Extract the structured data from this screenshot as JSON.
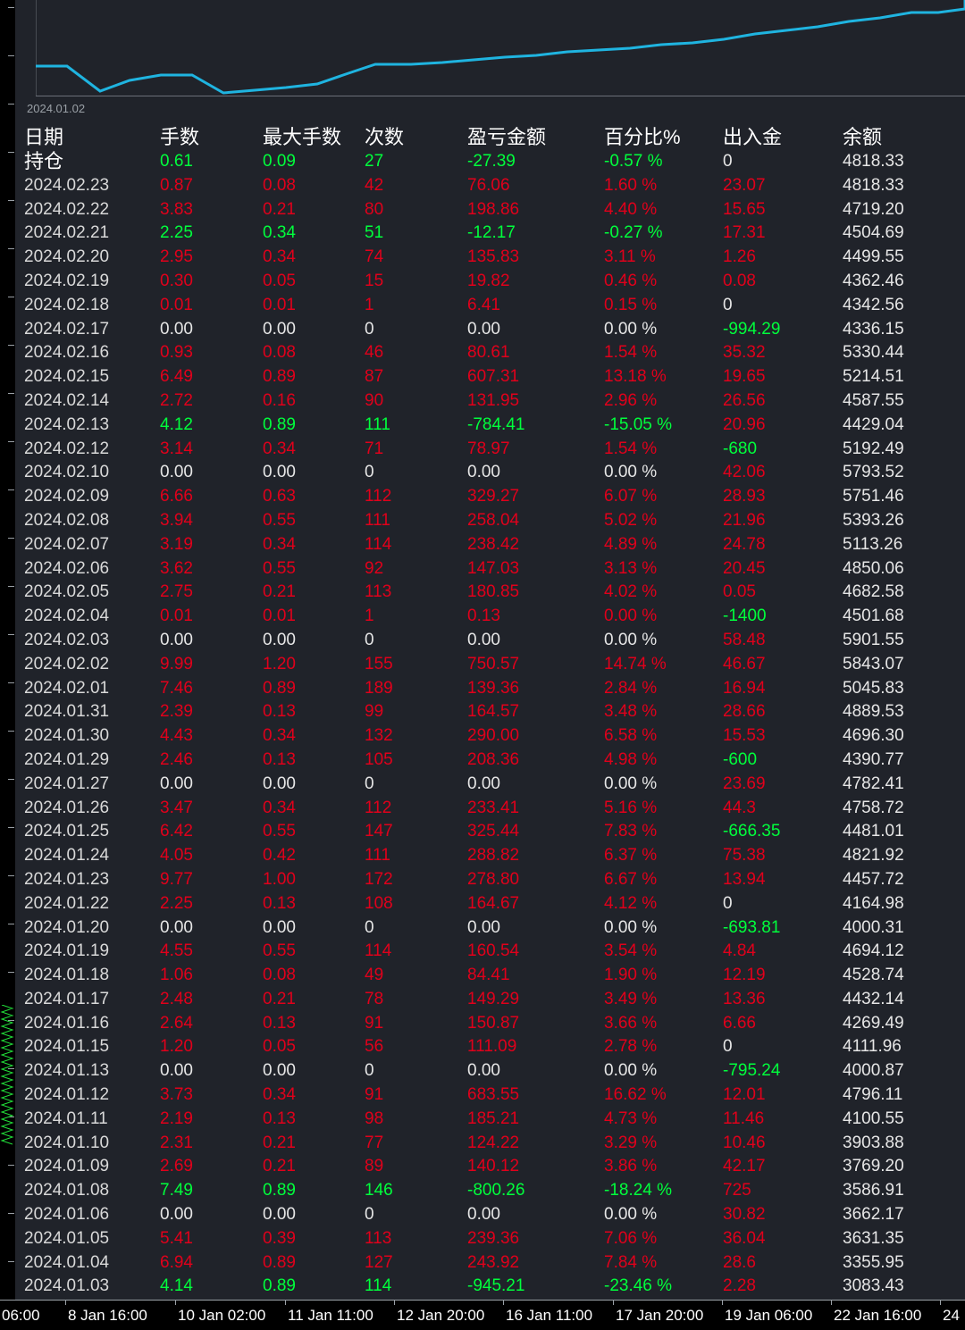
{
  "window": {
    "title": ""
  },
  "equity_curve": {
    "start_label": "2024.01.02",
    "line_color": "#1fb4e0",
    "values": [
      74,
      74,
      102,
      90,
      84,
      84,
      104,
      101,
      98,
      94,
      82,
      72,
      72,
      70,
      67,
      64,
      62,
      58,
      56,
      54,
      50,
      48,
      44,
      38,
      34,
      30,
      24,
      20,
      14,
      14,
      10,
      5,
      2,
      0
    ]
  },
  "stats_table": {
    "headers": [
      "日期",
      "手数",
      "最大手数",
      "次数",
      "盈亏金额",
      "百分比%",
      "出入金",
      "余额"
    ],
    "rows": [
      {
        "date": "持仓",
        "lots": "0.61",
        "max_lots": "0.09",
        "count": "27",
        "pnl": "-27.39",
        "pct": "-0.57 %",
        "cash": "0",
        "balance": "4818.33",
        "color": "g",
        "cash_color": "w"
      },
      {
        "date": "2024.02.23",
        "lots": "0.87",
        "max_lots": "0.08",
        "count": "42",
        "pnl": "76.06",
        "pct": "1.60 %",
        "cash": "23.07",
        "balance": "4818.33",
        "color": "r",
        "cash_color": "r"
      },
      {
        "date": "2024.02.22",
        "lots": "3.83",
        "max_lots": "0.21",
        "count": "80",
        "pnl": "198.86",
        "pct": "4.40 %",
        "cash": "15.65",
        "balance": "4719.20",
        "color": "r",
        "cash_color": "r"
      },
      {
        "date": "2024.02.21",
        "lots": "2.25",
        "max_lots": "0.34",
        "count": "51",
        "pnl": "-12.17",
        "pct": "-0.27 %",
        "cash": "17.31",
        "balance": "4504.69",
        "color": "g",
        "cash_color": "r"
      },
      {
        "date": "2024.02.20",
        "lots": "2.95",
        "max_lots": "0.34",
        "count": "74",
        "pnl": "135.83",
        "pct": "3.11 %",
        "cash": "1.26",
        "balance": "4499.55",
        "color": "r",
        "cash_color": "r"
      },
      {
        "date": "2024.02.19",
        "lots": "0.30",
        "max_lots": "0.05",
        "count": "15",
        "pnl": "19.82",
        "pct": "0.46 %",
        "cash": "0.08",
        "balance": "4362.46",
        "color": "r",
        "cash_color": "r"
      },
      {
        "date": "2024.02.18",
        "lots": "0.01",
        "max_lots": "0.01",
        "count": "1",
        "pnl": "6.41",
        "pct": "0.15 %",
        "cash": "0",
        "balance": "4342.56",
        "color": "r",
        "cash_color": "w"
      },
      {
        "date": "2024.02.17",
        "lots": "0.00",
        "max_lots": "0.00",
        "count": "0",
        "pnl": "0.00",
        "pct": "0.00 %",
        "cash": "-994.29",
        "balance": "4336.15",
        "color": "w",
        "cash_color": "g"
      },
      {
        "date": "2024.02.16",
        "lots": "0.93",
        "max_lots": "0.08",
        "count": "46",
        "pnl": "80.61",
        "pct": "1.54 %",
        "cash": "35.32",
        "balance": "5330.44",
        "color": "r",
        "cash_color": "r"
      },
      {
        "date": "2024.02.15",
        "lots": "6.49",
        "max_lots": "0.89",
        "count": "87",
        "pnl": "607.31",
        "pct": "13.18 %",
        "cash": "19.65",
        "balance": "5214.51",
        "color": "r",
        "cash_color": "r"
      },
      {
        "date": "2024.02.14",
        "lots": "2.72",
        "max_lots": "0.16",
        "count": "90",
        "pnl": "131.95",
        "pct": "2.96 %",
        "cash": "26.56",
        "balance": "4587.55",
        "color": "r",
        "cash_color": "r"
      },
      {
        "date": "2024.02.13",
        "lots": "4.12",
        "max_lots": "0.89",
        "count": "111",
        "pnl": "-784.41",
        "pct": "-15.05 %",
        "cash": "20.96",
        "balance": "4429.04",
        "color": "g",
        "cash_color": "r"
      },
      {
        "date": "2024.02.12",
        "lots": "3.14",
        "max_lots": "0.34",
        "count": "71",
        "pnl": "78.97",
        "pct": "1.54 %",
        "cash": "-680",
        "balance": "5192.49",
        "color": "r",
        "cash_color": "g"
      },
      {
        "date": "2024.02.10",
        "lots": "0.00",
        "max_lots": "0.00",
        "count": "0",
        "pnl": "0.00",
        "pct": "0.00 %",
        "cash": "42.06",
        "balance": "5793.52",
        "color": "w",
        "cash_color": "r"
      },
      {
        "date": "2024.02.09",
        "lots": "6.66",
        "max_lots": "0.63",
        "count": "112",
        "pnl": "329.27",
        "pct": "6.07 %",
        "cash": "28.93",
        "balance": "5751.46",
        "color": "r",
        "cash_color": "r"
      },
      {
        "date": "2024.02.08",
        "lots": "3.94",
        "max_lots": "0.55",
        "count": "111",
        "pnl": "258.04",
        "pct": "5.02 %",
        "cash": "21.96",
        "balance": "5393.26",
        "color": "r",
        "cash_color": "r"
      },
      {
        "date": "2024.02.07",
        "lots": "3.19",
        "max_lots": "0.34",
        "count": "114",
        "pnl": "238.42",
        "pct": "4.89 %",
        "cash": "24.78",
        "balance": "5113.26",
        "color": "r",
        "cash_color": "r"
      },
      {
        "date": "2024.02.06",
        "lots": "3.62",
        "max_lots": "0.55",
        "count": "92",
        "pnl": "147.03",
        "pct": "3.13 %",
        "cash": "20.45",
        "balance": "4850.06",
        "color": "r",
        "cash_color": "r"
      },
      {
        "date": "2024.02.05",
        "lots": "2.75",
        "max_lots": "0.21",
        "count": "113",
        "pnl": "180.85",
        "pct": "4.02 %",
        "cash": "0.05",
        "balance": "4682.58",
        "color": "r",
        "cash_color": "r"
      },
      {
        "date": "2024.02.04",
        "lots": "0.01",
        "max_lots": "0.01",
        "count": "1",
        "pnl": "0.13",
        "pct": "0.00 %",
        "cash": "-1400",
        "balance": "4501.68",
        "color": "r",
        "cash_color": "g"
      },
      {
        "date": "2024.02.03",
        "lots": "0.00",
        "max_lots": "0.00",
        "count": "0",
        "pnl": "0.00",
        "pct": "0.00 %",
        "cash": "58.48",
        "balance": "5901.55",
        "color": "w",
        "cash_color": "r"
      },
      {
        "date": "2024.02.02",
        "lots": "9.99",
        "max_lots": "1.20",
        "count": "155",
        "pnl": "750.57",
        "pct": "14.74 %",
        "cash": "46.67",
        "balance": "5843.07",
        "color": "r",
        "cash_color": "r"
      },
      {
        "date": "2024.02.01",
        "lots": "7.46",
        "max_lots": "0.89",
        "count": "189",
        "pnl": "139.36",
        "pct": "2.84 %",
        "cash": "16.94",
        "balance": "5045.83",
        "color": "r",
        "cash_color": "r"
      },
      {
        "date": "2024.01.31",
        "lots": "2.39",
        "max_lots": "0.13",
        "count": "99",
        "pnl": "164.57",
        "pct": "3.48 %",
        "cash": "28.66",
        "balance": "4889.53",
        "color": "r",
        "cash_color": "r"
      },
      {
        "date": "2024.01.30",
        "lots": "4.43",
        "max_lots": "0.34",
        "count": "132",
        "pnl": "290.00",
        "pct": "6.58 %",
        "cash": "15.53",
        "balance": "4696.30",
        "color": "r",
        "cash_color": "r"
      },
      {
        "date": "2024.01.29",
        "lots": "2.46",
        "max_lots": "0.13",
        "count": "105",
        "pnl": "208.36",
        "pct": "4.98 %",
        "cash": "-600",
        "balance": "4390.77",
        "color": "r",
        "cash_color": "g"
      },
      {
        "date": "2024.01.27",
        "lots": "0.00",
        "max_lots": "0.00",
        "count": "0",
        "pnl": "0.00",
        "pct": "0.00 %",
        "cash": "23.69",
        "balance": "4782.41",
        "color": "w",
        "cash_color": "r"
      },
      {
        "date": "2024.01.26",
        "lots": "3.47",
        "max_lots": "0.34",
        "count": "112",
        "pnl": "233.41",
        "pct": "5.16 %",
        "cash": "44.3",
        "balance": "4758.72",
        "color": "r",
        "cash_color": "r"
      },
      {
        "date": "2024.01.25",
        "lots": "6.42",
        "max_lots": "0.55",
        "count": "147",
        "pnl": "325.44",
        "pct": "7.83 %",
        "cash": "-666.35",
        "balance": "4481.01",
        "color": "r",
        "cash_color": "g"
      },
      {
        "date": "2024.01.24",
        "lots": "4.05",
        "max_lots": "0.42",
        "count": "111",
        "pnl": "288.82",
        "pct": "6.37 %",
        "cash": "75.38",
        "balance": "4821.92",
        "color": "r",
        "cash_color": "r"
      },
      {
        "date": "2024.01.23",
        "lots": "9.77",
        "max_lots": "1.00",
        "count": "172",
        "pnl": "278.80",
        "pct": "6.67 %",
        "cash": "13.94",
        "balance": "4457.72",
        "color": "r",
        "cash_color": "r"
      },
      {
        "date": "2024.01.22",
        "lots": "2.25",
        "max_lots": "0.13",
        "count": "108",
        "pnl": "164.67",
        "pct": "4.12 %",
        "cash": "0",
        "balance": "4164.98",
        "color": "r",
        "cash_color": "w"
      },
      {
        "date": "2024.01.20",
        "lots": "0.00",
        "max_lots": "0.00",
        "count": "0",
        "pnl": "0.00",
        "pct": "0.00 %",
        "cash": "-693.81",
        "balance": "4000.31",
        "color": "w",
        "cash_color": "g"
      },
      {
        "date": "2024.01.19",
        "lots": "4.55",
        "max_lots": "0.55",
        "count": "114",
        "pnl": "160.54",
        "pct": "3.54 %",
        "cash": "4.84",
        "balance": "4694.12",
        "color": "r",
        "cash_color": "r"
      },
      {
        "date": "2024.01.18",
        "lots": "1.06",
        "max_lots": "0.08",
        "count": "49",
        "pnl": "84.41",
        "pct": "1.90 %",
        "cash": "12.19",
        "balance": "4528.74",
        "color": "r",
        "cash_color": "r"
      },
      {
        "date": "2024.01.17",
        "lots": "2.48",
        "max_lots": "0.21",
        "count": "78",
        "pnl": "149.29",
        "pct": "3.49 %",
        "cash": "13.36",
        "balance": "4432.14",
        "color": "r",
        "cash_color": "r"
      },
      {
        "date": "2024.01.16",
        "lots": "2.64",
        "max_lots": "0.13",
        "count": "91",
        "pnl": "150.87",
        "pct": "3.66 %",
        "cash": "6.66",
        "balance": "4269.49",
        "color": "r",
        "cash_color": "r"
      },
      {
        "date": "2024.01.15",
        "lots": "1.20",
        "max_lots": "0.05",
        "count": "56",
        "pnl": "111.09",
        "pct": "2.78 %",
        "cash": "0",
        "balance": "4111.96",
        "color": "r",
        "cash_color": "w"
      },
      {
        "date": "2024.01.13",
        "lots": "0.00",
        "max_lots": "0.00",
        "count": "0",
        "pnl": "0.00",
        "pct": "0.00 %",
        "cash": "-795.24",
        "balance": "4000.87",
        "color": "w",
        "cash_color": "g"
      },
      {
        "date": "2024.01.12",
        "lots": "3.73",
        "max_lots": "0.34",
        "count": "91",
        "pnl": "683.55",
        "pct": "16.62 %",
        "cash": "12.01",
        "balance": "4796.11",
        "color": "r",
        "cash_color": "r"
      },
      {
        "date": "2024.01.11",
        "lots": "2.19",
        "max_lots": "0.13",
        "count": "98",
        "pnl": "185.21",
        "pct": "4.73 %",
        "cash": "11.46",
        "balance": "4100.55",
        "color": "r",
        "cash_color": "r"
      },
      {
        "date": "2024.01.10",
        "lots": "2.31",
        "max_lots": "0.21",
        "count": "77",
        "pnl": "124.22",
        "pct": "3.29 %",
        "cash": "10.46",
        "balance": "3903.88",
        "color": "r",
        "cash_color": "r"
      },
      {
        "date": "2024.01.09",
        "lots": "2.69",
        "max_lots": "0.21",
        "count": "89",
        "pnl": "140.12",
        "pct": "3.86 %",
        "cash": "42.17",
        "balance": "3769.20",
        "color": "r",
        "cash_color": "r"
      },
      {
        "date": "2024.01.08",
        "lots": "7.49",
        "max_lots": "0.89",
        "count": "146",
        "pnl": "-800.26",
        "pct": "-18.24 %",
        "cash": "725",
        "balance": "3586.91",
        "color": "g",
        "cash_color": "r"
      },
      {
        "date": "2024.01.06",
        "lots": "0.00",
        "max_lots": "0.00",
        "count": "0",
        "pnl": "0.00",
        "pct": "0.00 %",
        "cash": "30.82",
        "balance": "3662.17",
        "color": "w",
        "cash_color": "r"
      },
      {
        "date": "2024.01.05",
        "lots": "5.41",
        "max_lots": "0.39",
        "count": "113",
        "pnl": "239.36",
        "pct": "7.06 %",
        "cash": "36.04",
        "balance": "3631.35",
        "color": "r",
        "cash_color": "r"
      },
      {
        "date": "2024.01.04",
        "lots": "6.94",
        "max_lots": "0.89",
        "count": "127",
        "pnl": "243.92",
        "pct": "7.84 %",
        "cash": "28.6",
        "balance": "3355.95",
        "color": "r",
        "cash_color": "r"
      },
      {
        "date": "2024.01.03",
        "lots": "4.14",
        "max_lots": "0.89",
        "count": "114",
        "pnl": "-945.21",
        "pct": "-23.46 %",
        "cash": "2.28",
        "balance": "3083.43",
        "color": "g",
        "cash_color": "r"
      }
    ]
  },
  "time_axis": {
    "labels": [
      "06:00",
      "8 Jan 16:00",
      "10 Jan 02:00",
      "11 Jan 11:00",
      "12 Jan 20:00",
      "16 Jan 11:00",
      "17 Jan 20:00",
      "19 Jan 06:00",
      "22 Jan 16:00",
      "24"
    ]
  },
  "colors": {
    "profit": "#e0001b",
    "loss": "#00ff3c",
    "neutral": "#e6e6e6",
    "background": "#20232a"
  }
}
